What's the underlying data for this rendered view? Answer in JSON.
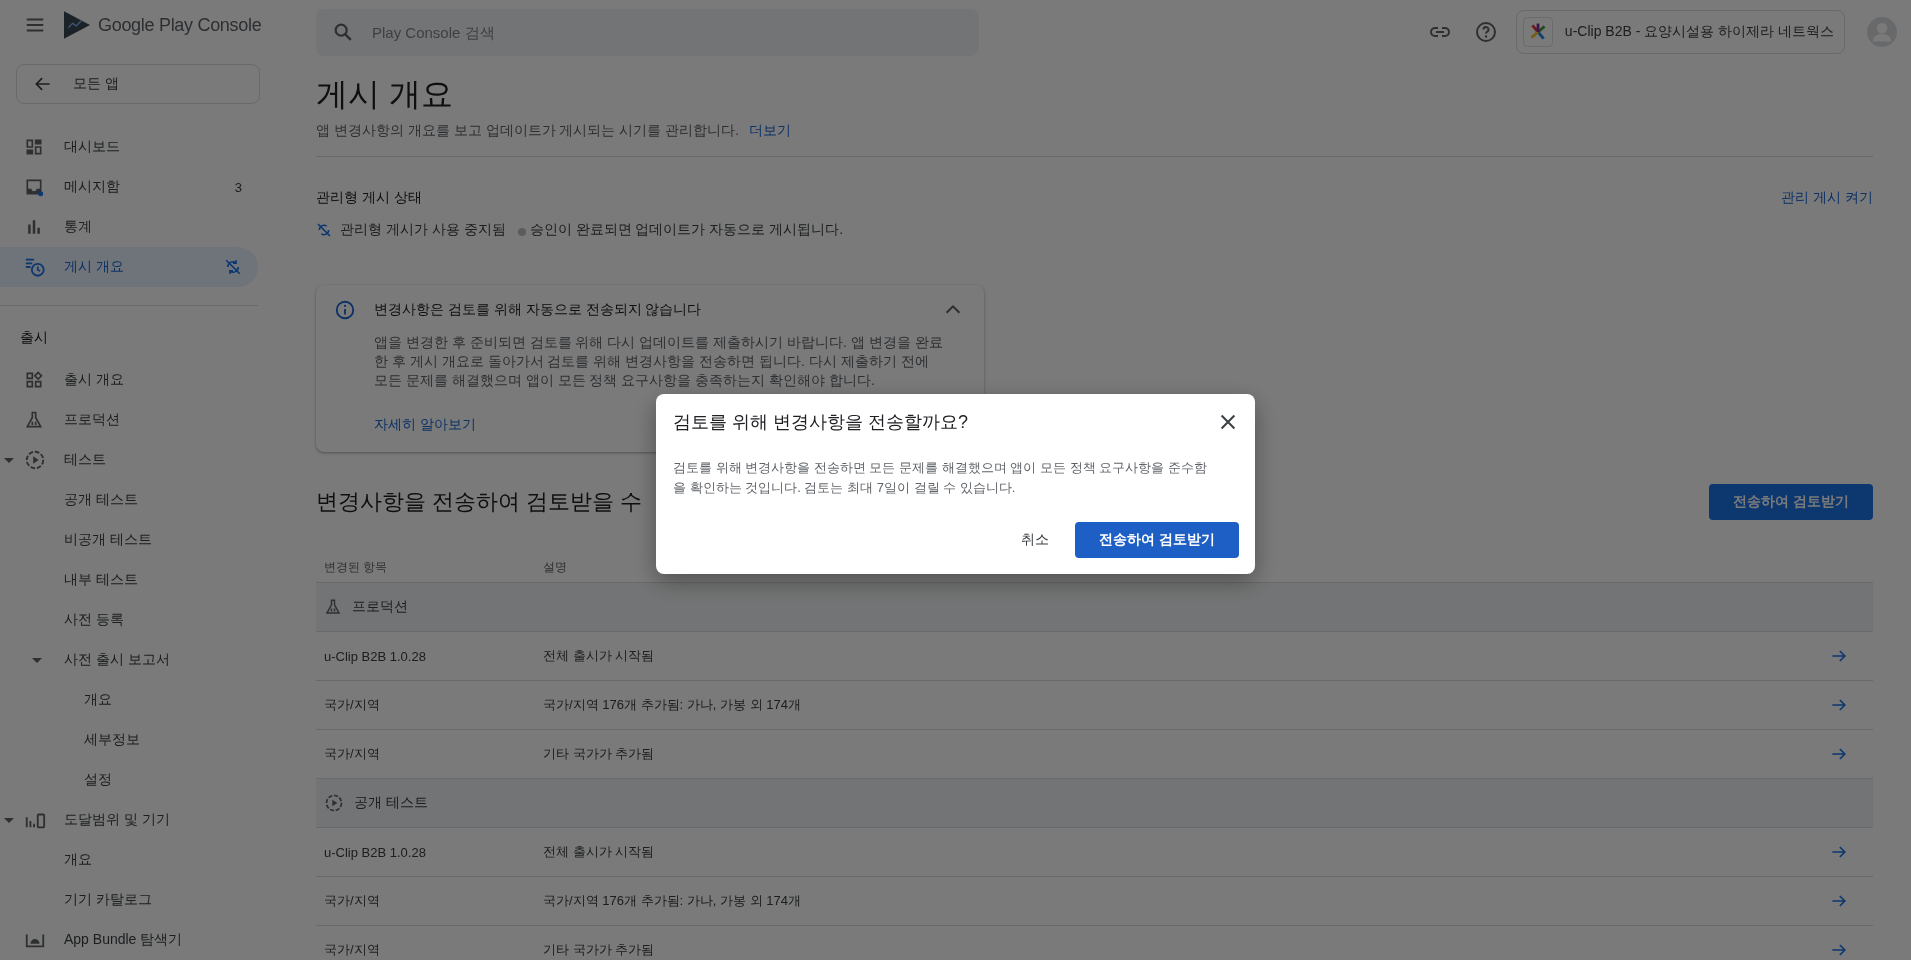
{
  "header": {
    "logo_text": "Google Play Console",
    "search": {
      "placeholder": "Play Console 검색"
    },
    "account": {
      "name": "u-Clip B2B - 요양시설용 하이제라 네트웍스"
    }
  },
  "sidebar": {
    "back_button": "모든 앱",
    "groups": [
      {
        "items": [
          {
            "label": "대시보드",
            "selected": false
          },
          {
            "label": "메시지함",
            "selected": false,
            "badge": "3"
          },
          {
            "label": "통계",
            "selected": false
          },
          {
            "label": "게시 개요",
            "selected": true
          }
        ]
      },
      {
        "heading": "출시",
        "items": [
          {
            "label": "출시 개요",
            "selected": false
          },
          {
            "label": "프로덕션",
            "selected": false
          },
          {
            "label": "테스트",
            "selected": false,
            "expanded": true,
            "children": [
              {
                "label": "공개 테스트",
                "selected": false
              },
              {
                "label": "비공개 테스트",
                "selected": false
              },
              {
                "label": "내부 테스트",
                "selected": false
              },
              {
                "label": "사전 등록",
                "selected": false
              },
              {
                "label": "사전 출시 보고서",
                "selected": false,
                "expanded": true,
                "children": [
                  {
                    "label": "개요",
                    "selected": false
                  },
                  {
                    "label": "세부정보",
                    "selected": false
                  },
                  {
                    "label": "설정",
                    "selected": false
                  }
                ]
              }
            ]
          },
          {
            "label": "도달범위 및 기기",
            "selected": false,
            "expanded": true,
            "children": [
              {
                "label": "개요",
                "selected": false
              },
              {
                "label": "기기 카탈로그",
                "selected": false
              }
            ]
          },
          {
            "label": "App Bundle 탐색기",
            "selected": false
          }
        ]
      }
    ]
  },
  "page": {
    "title": "게시 개요",
    "subtitle": "앱 변경사항의 개요를 보고 업데이트가 게시되는 시기를 관리합니다.",
    "subtitle_link": "더보기",
    "managed_publishing": {
      "heading": "관리형 게시 상태",
      "action_link": "관리 게시 켜기",
      "status": "관리형 게시가 사용 중지됨",
      "note": "승인이 완료되면 업데이트가 자동으로 게시됩니다."
    },
    "info_card": {
      "title": "변경사항은 검토를 위해 자동으로 전송되지 않습니다",
      "expanded": true,
      "body": "앱을 변경한 후 준비되면 검토를 위해 다시 업데이트를 제출하시기 바랍니다. 앱 변경을 완료한 후 게시 개요로 돌아가서 검토를 위해 변경사항을 전송하면 됩니다. 다시 제출하기 전에 모든 문제를 해결했으며 앱이 모든 정책 요구사항을 충족하는지 확인해야 합니다.",
      "link": "자세히 알아보기"
    },
    "changes": {
      "heading": "변경사항을 전송하여 검토받을 수",
      "send_button": "전송하여 검토받기",
      "table": {
        "columns": [
          "변경된 항목",
          "설명"
        ],
        "groups": [
          {
            "name": "프로덕션",
            "rows": [
              {
                "item": "u-Clip B2B 1.0.28",
                "description": "전체 출시가 시작됨"
              },
              {
                "item": "국가/지역",
                "description": "국가/지역 176개 추가됨: 가나, 가봉 외 174개"
              },
              {
                "item": "국가/지역",
                "description": "기타 국가가 추가됨"
              }
            ]
          },
          {
            "name": "공개 테스트",
            "rows": [
              {
                "item": "u-Clip B2B 1.0.28",
                "description": "전체 출시가 시작됨"
              },
              {
                "item": "국가/지역",
                "description": "국가/지역 176개 추가됨: 가나, 가봉 외 174개"
              },
              {
                "item": "국가/지역",
                "description": "기타 국가가 추가됨"
              }
            ]
          }
        ]
      }
    }
  },
  "dialog": {
    "title": "검토를 위해 변경사항을 전송할까요?",
    "body": "검토를 위해 변경사항을 전송하면 모든 문제를 해결했으며 앱이 모든 정책 요구사항을 준수함을 확인하는 것입니다. 검토는 최대 7일이 걸릴 수 있습니다.",
    "cancel_button": "취소",
    "confirm_button": "전송하여 검토받기"
  }
}
